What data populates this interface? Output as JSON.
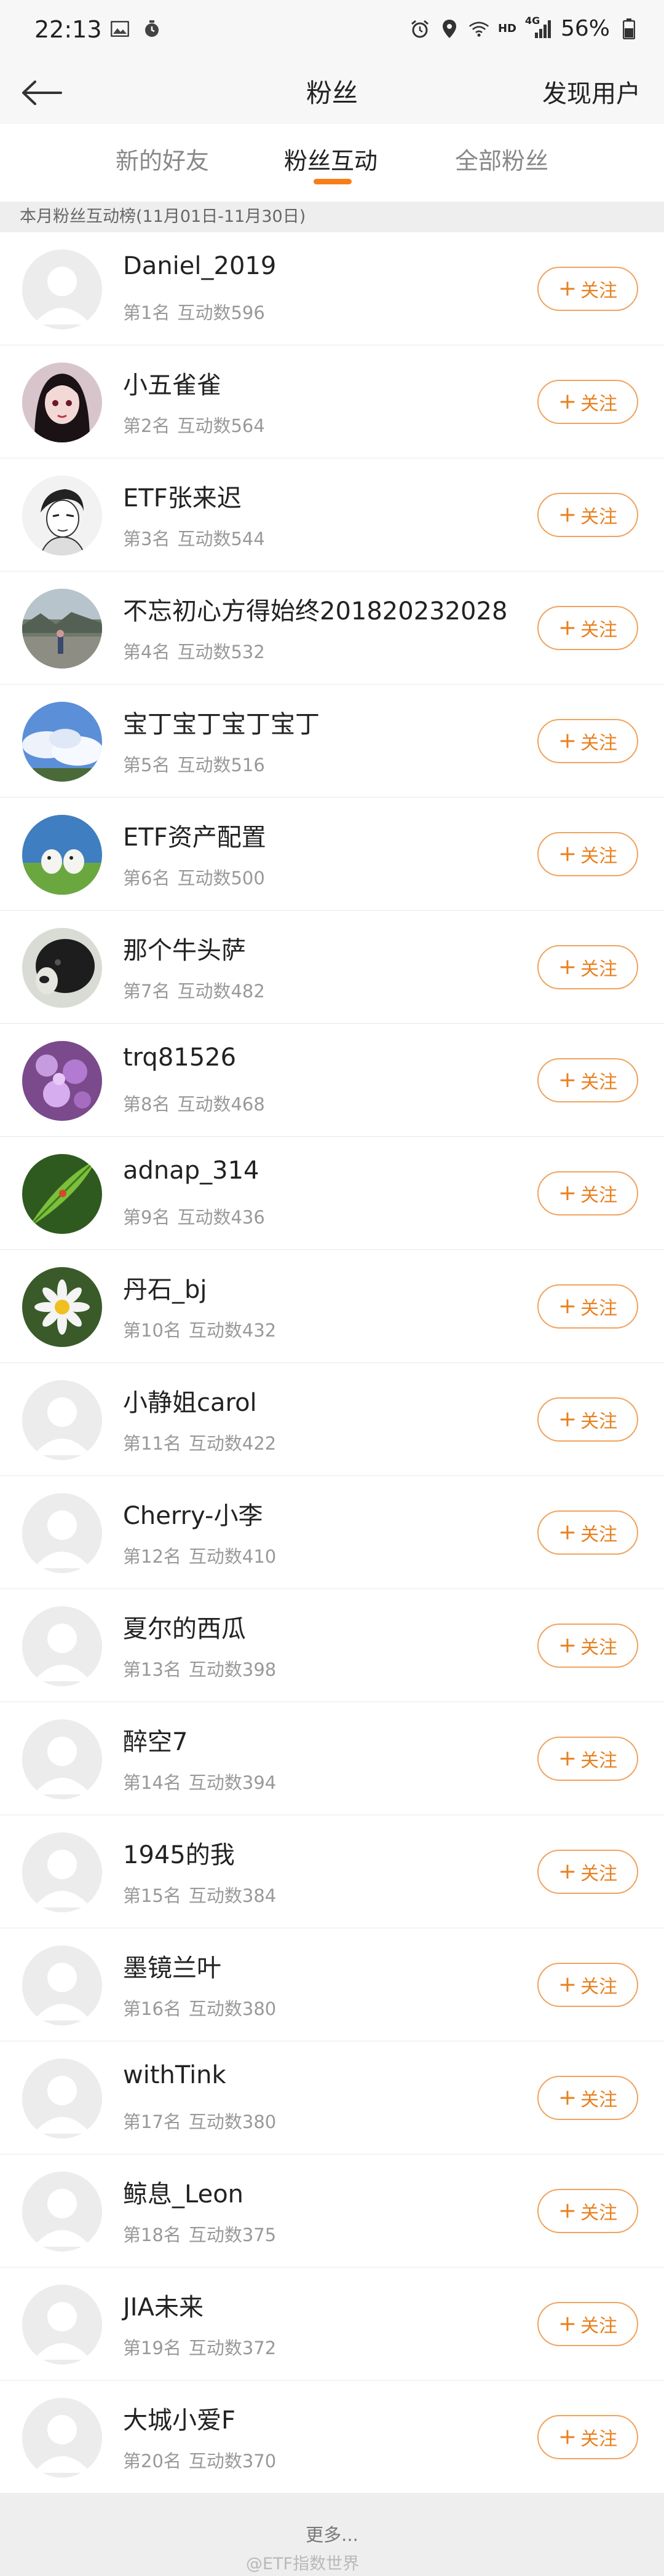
{
  "status_bar": {
    "time": "22:13",
    "network": "HD",
    "signal": "4G",
    "battery": "56%"
  },
  "nav": {
    "title": "粉丝",
    "right_action": "发现用户"
  },
  "tabs": [
    {
      "label": "新的好友",
      "active": false
    },
    {
      "label": "粉丝互动",
      "active": true
    },
    {
      "label": "全部粉丝",
      "active": false
    }
  ],
  "section_header": "本月粉丝互动榜(11月01日-11月30日)",
  "follow_label": "关注",
  "accent_color": "#f77d19",
  "fans": [
    {
      "name": "Daniel_2019",
      "rank": "第1名",
      "interactions": "互动数596",
      "avatar": "default"
    },
    {
      "name": "小五雀雀",
      "rank": "第2名",
      "interactions": "互动数564",
      "avatar": "anime-girl"
    },
    {
      "name": "ETF张来迟",
      "rank": "第3名",
      "interactions": "互动数544",
      "avatar": "sketch"
    },
    {
      "name": "不忘初心方得始终201820232028",
      "rank": "第4名",
      "interactions": "互动数532",
      "avatar": "outdoor"
    },
    {
      "name": "宝丁宝丁宝丁宝丁",
      "rank": "第5名",
      "interactions": "互动数516",
      "avatar": "sky"
    },
    {
      "name": "ETF资产配置",
      "rank": "第6名",
      "interactions": "互动数500",
      "avatar": "birds"
    },
    {
      "name": "那个牛头萨",
      "rank": "第7名",
      "interactions": "互动数482",
      "avatar": "dog"
    },
    {
      "name": "trq81526",
      "rank": "第8名",
      "interactions": "互动数468",
      "avatar": "flower-purple"
    },
    {
      "name": "adnap_314",
      "rank": "第9名",
      "interactions": "互动数436",
      "avatar": "leaf"
    },
    {
      "name": "丹石_bj",
      "rank": "第10名",
      "interactions": "互动数432",
      "avatar": "daisy"
    },
    {
      "name": "小静姐carol",
      "rank": "第11名",
      "interactions": "互动数422",
      "avatar": "default"
    },
    {
      "name": "Cherry-小李",
      "rank": "第12名",
      "interactions": "互动数410",
      "avatar": "default"
    },
    {
      "name": "夏尔的西瓜",
      "rank": "第13名",
      "interactions": "互动数398",
      "avatar": "default"
    },
    {
      "name": "醉空7",
      "rank": "第14名",
      "interactions": "互动数394",
      "avatar": "default"
    },
    {
      "name": "1945的我",
      "rank": "第15名",
      "interactions": "互动数384",
      "avatar": "default"
    },
    {
      "name": "墨镜兰叶",
      "rank": "第16名",
      "interactions": "互动数380",
      "avatar": "default"
    },
    {
      "name": "withTink",
      "rank": "第17名",
      "interactions": "互动数380",
      "avatar": "default"
    },
    {
      "name": "鲸息_Leon",
      "rank": "第18名",
      "interactions": "互动数375",
      "avatar": "default"
    },
    {
      "name": "JIA未来",
      "rank": "第19名",
      "interactions": "互动数372",
      "avatar": "default"
    },
    {
      "name": "大城小爱F",
      "rank": "第20名",
      "interactions": "互动数370",
      "avatar": "default"
    }
  ],
  "footer": {
    "more": "更多...",
    "watermark": "@ETF指数世界"
  }
}
